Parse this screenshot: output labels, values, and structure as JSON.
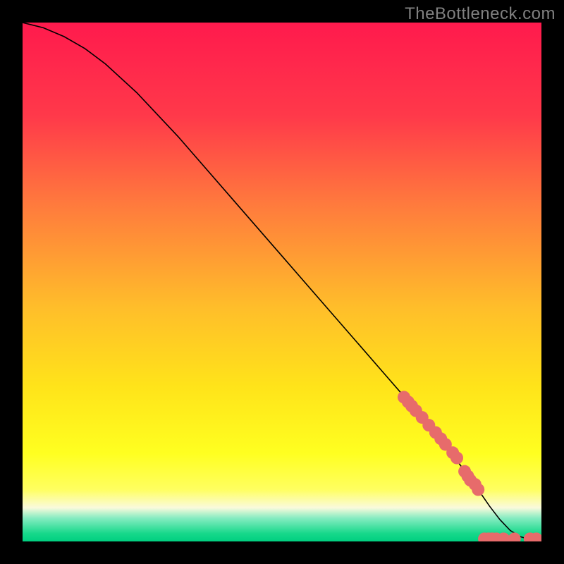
{
  "watermark": "TheBottleneck.com",
  "chart_data": {
    "type": "line",
    "title": "",
    "xlabel": "",
    "ylabel": "",
    "xlim": [
      0,
      100
    ],
    "ylim": [
      0,
      100
    ],
    "background_gradient_stops": [
      {
        "pos": 0.0,
        "color": "#ff1a4d"
      },
      {
        "pos": 0.18,
        "color": "#ff394a"
      },
      {
        "pos": 0.35,
        "color": "#ff7a3d"
      },
      {
        "pos": 0.55,
        "color": "#ffbe2a"
      },
      {
        "pos": 0.7,
        "color": "#ffe31a"
      },
      {
        "pos": 0.83,
        "color": "#ffff20"
      },
      {
        "pos": 0.9,
        "color": "#ffff60"
      },
      {
        "pos": 0.935,
        "color": "#fafadc"
      },
      {
        "pos": 0.955,
        "color": "#86ecc1"
      },
      {
        "pos": 0.985,
        "color": "#16d88a"
      },
      {
        "pos": 1.0,
        "color": "#00cf80"
      }
    ],
    "series": [
      {
        "name": "bottleneck-curve",
        "color": "#000000",
        "x": [
          0,
          4,
          8,
          12,
          16,
          22,
          30,
          40,
          50,
          60,
          70,
          78,
          84,
          86.5,
          88,
          90,
          92,
          94,
          96,
          98,
          100
        ],
        "y": [
          100,
          99,
          97.3,
          95,
          92,
          86.5,
          78,
          66.5,
          55,
          43.5,
          32,
          22.8,
          15.2,
          11.8,
          9.7,
          6.8,
          4.2,
          2.1,
          0.9,
          0.3,
          0
        ]
      }
    ],
    "points": {
      "name": "sample-points",
      "color": "#e76b6b",
      "radius_px": 9,
      "data": [
        {
          "x": 73.5,
          "y": 27.8
        },
        {
          "x": 74.3,
          "y": 26.9
        },
        {
          "x": 75.0,
          "y": 26.1
        },
        {
          "x": 75.8,
          "y": 25.2
        },
        {
          "x": 77.0,
          "y": 23.9
        },
        {
          "x": 78.3,
          "y": 22.4
        },
        {
          "x": 79.6,
          "y": 21.0
        },
        {
          "x": 80.6,
          "y": 19.8
        },
        {
          "x": 81.5,
          "y": 18.7
        },
        {
          "x": 82.9,
          "y": 17.1
        },
        {
          "x": 83.7,
          "y": 16.1
        },
        {
          "x": 85.2,
          "y": 13.5
        },
        {
          "x": 85.8,
          "y": 12.6
        },
        {
          "x": 86.3,
          "y": 11.8
        },
        {
          "x": 87.2,
          "y": 11.0
        },
        {
          "x": 87.8,
          "y": 10.0
        },
        {
          "x": 89.0,
          "y": 0.5
        },
        {
          "x": 89.8,
          "y": 0.5
        },
        {
          "x": 90.5,
          "y": 0.5
        },
        {
          "x": 91.3,
          "y": 0.5
        },
        {
          "x": 92.7,
          "y": 0.5
        },
        {
          "x": 94.8,
          "y": 0.5
        },
        {
          "x": 97.8,
          "y": 0.5
        },
        {
          "x": 99.0,
          "y": 0.5
        }
      ]
    }
  }
}
